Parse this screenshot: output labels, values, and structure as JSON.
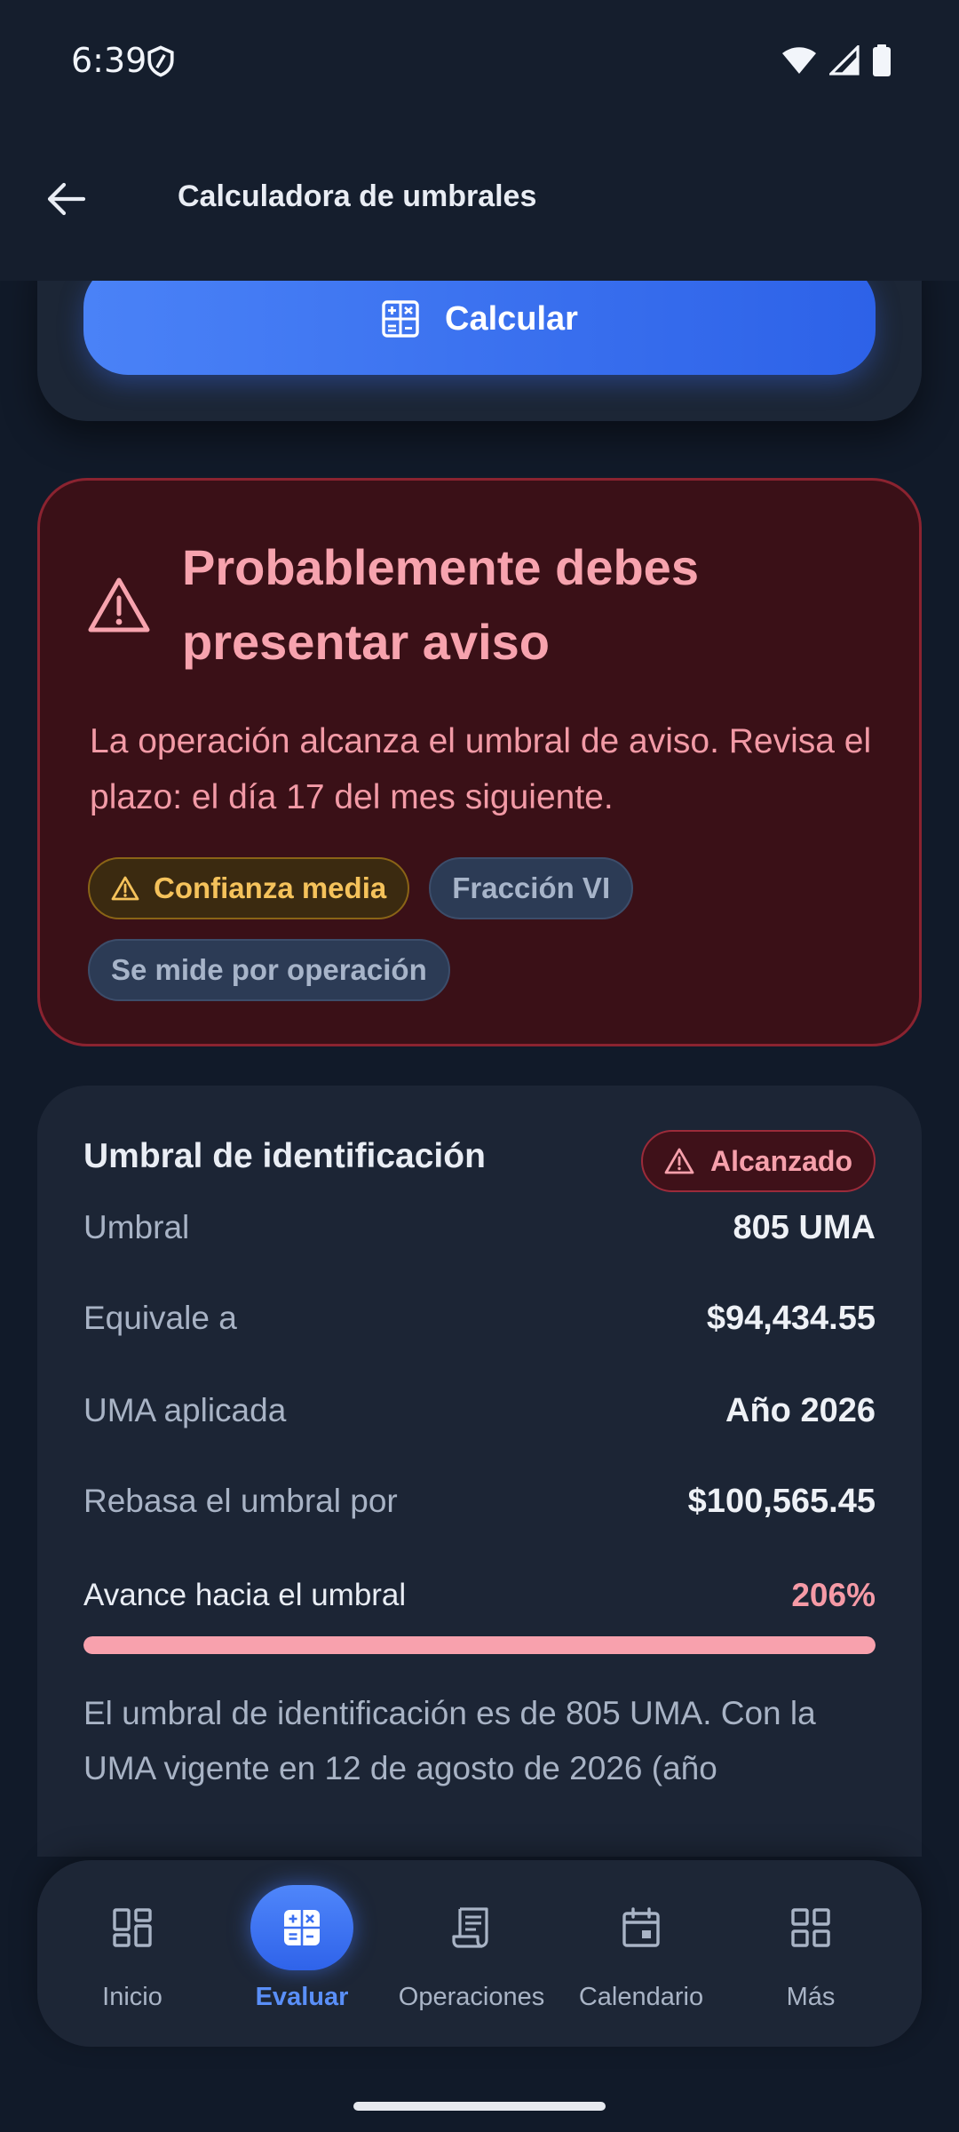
{
  "status_bar": {
    "time": "6:39"
  },
  "app_bar": {
    "title": "Calculadora de umbrales"
  },
  "calculate": {
    "label": "Calcular"
  },
  "alert": {
    "title": "Probablemente debes presentar aviso",
    "body": "La operación alcanza el umbral de aviso. Revisa el plazo: el día 17 del mes siguiente.",
    "chips": [
      "Confianza media",
      "Fracción VI",
      "Se mide por operación"
    ]
  },
  "identification": {
    "title": "Umbral de identificación",
    "badge": "Alcanzado",
    "rows": [
      {
        "label": "Umbral",
        "value": "805 UMA"
      },
      {
        "label": "Equivale a",
        "value": "$94,434.55"
      },
      {
        "label": "UMA aplicada",
        "value": "Año 2026"
      },
      {
        "label": "Rebasa el umbral por",
        "value": "$100,565.45"
      }
    ],
    "progress_label": "Avance hacia el umbral",
    "progress_text": "206%",
    "progress_fraction": 1.0,
    "description": "El umbral de identificación es de 805 UMA. Con la UMA vigente en 12 de agosto de 2026 (año"
  },
  "bottom_nav": {
    "items": [
      {
        "label": "Inicio",
        "icon": "dashboard-icon"
      },
      {
        "label": "Evaluar",
        "icon": "calculator-icon",
        "active": true
      },
      {
        "label": "Operaciones",
        "icon": "receipt-icon"
      },
      {
        "label": "Calendario",
        "icon": "calendar-icon"
      },
      {
        "label": "Más",
        "icon": "grid-icon"
      }
    ]
  },
  "colors": {
    "accent": "#3b6ff0",
    "danger_text": "#f7a3ae",
    "warning_text": "#f5c25b",
    "background": "#111a29"
  }
}
